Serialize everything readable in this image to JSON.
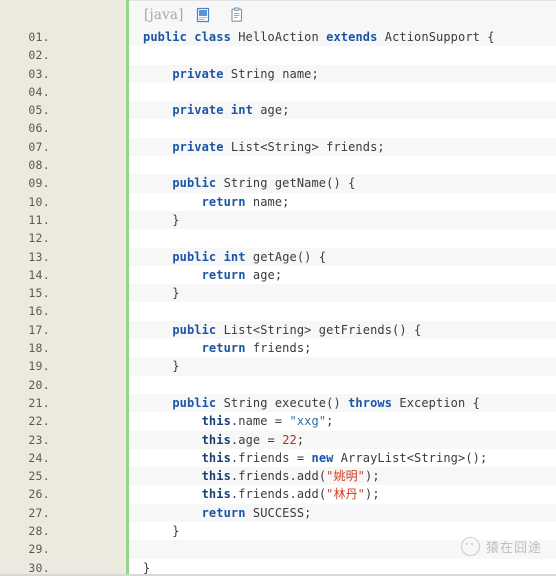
{
  "toolbar": {
    "language_label": "[java]",
    "icons": [
      {
        "name": "view-source-icon",
        "glyph": "view-source"
      },
      {
        "name": "copy-to-clipboard-icon",
        "glyph": "clipboard"
      }
    ]
  },
  "editor": {
    "line_numbers": [
      "01.",
      "02.",
      "03.",
      "04.",
      "05.",
      "06.",
      "07.",
      "08.",
      "09.",
      "10.",
      "11.",
      "12.",
      "13.",
      "14.",
      "15.",
      "16.",
      "17.",
      "18.",
      "19.",
      "20.",
      "21.",
      "22.",
      "23.",
      "24.",
      "25.",
      "26.",
      "27.",
      "28.",
      "29.",
      "30."
    ],
    "lines": [
      {
        "num": "01.",
        "tokens": [
          {
            "t": "public",
            "c": "k"
          },
          {
            "t": " ",
            "c": "p"
          },
          {
            "t": "class",
            "c": "k"
          },
          {
            "t": " HelloAction ",
            "c": "p"
          },
          {
            "t": "extends",
            "c": "k"
          },
          {
            "t": " ActionSupport {",
            "c": "p"
          }
        ]
      },
      {
        "num": "02.",
        "tokens": []
      },
      {
        "num": "03.",
        "tokens": [
          {
            "t": "    ",
            "c": "p"
          },
          {
            "t": "private",
            "c": "k"
          },
          {
            "t": " String name;",
            "c": "p"
          }
        ]
      },
      {
        "num": "04.",
        "tokens": []
      },
      {
        "num": "05.",
        "tokens": [
          {
            "t": "    ",
            "c": "p"
          },
          {
            "t": "private",
            "c": "k"
          },
          {
            "t": " ",
            "c": "p"
          },
          {
            "t": "int",
            "c": "k"
          },
          {
            "t": " age;",
            "c": "p"
          }
        ]
      },
      {
        "num": "06.",
        "tokens": []
      },
      {
        "num": "07.",
        "tokens": [
          {
            "t": "    ",
            "c": "p"
          },
          {
            "t": "private",
            "c": "k"
          },
          {
            "t": " List<String> friends;",
            "c": "p"
          }
        ]
      },
      {
        "num": "08.",
        "tokens": []
      },
      {
        "num": "09.",
        "tokens": [
          {
            "t": "    ",
            "c": "p"
          },
          {
            "t": "public",
            "c": "k"
          },
          {
            "t": " String getName() {",
            "c": "p"
          }
        ]
      },
      {
        "num": "10.",
        "tokens": [
          {
            "t": "        ",
            "c": "p"
          },
          {
            "t": "return",
            "c": "k"
          },
          {
            "t": " name;",
            "c": "p"
          }
        ]
      },
      {
        "num": "11.",
        "tokens": [
          {
            "t": "    }",
            "c": "p"
          }
        ]
      },
      {
        "num": "12.",
        "tokens": []
      },
      {
        "num": "13.",
        "tokens": [
          {
            "t": "    ",
            "c": "p"
          },
          {
            "t": "public",
            "c": "k"
          },
          {
            "t": " ",
            "c": "p"
          },
          {
            "t": "int",
            "c": "k"
          },
          {
            "t": " getAge() {",
            "c": "p"
          }
        ]
      },
      {
        "num": "14.",
        "tokens": [
          {
            "t": "        ",
            "c": "p"
          },
          {
            "t": "return",
            "c": "k"
          },
          {
            "t": " age;",
            "c": "p"
          }
        ]
      },
      {
        "num": "15.",
        "tokens": [
          {
            "t": "    }",
            "c": "p"
          }
        ]
      },
      {
        "num": "16.",
        "tokens": []
      },
      {
        "num": "17.",
        "tokens": [
          {
            "t": "    ",
            "c": "p"
          },
          {
            "t": "public",
            "c": "k"
          },
          {
            "t": " List<String> getFriends() {",
            "c": "p"
          }
        ]
      },
      {
        "num": "18.",
        "tokens": [
          {
            "t": "        ",
            "c": "p"
          },
          {
            "t": "return",
            "c": "k"
          },
          {
            "t": " friends;",
            "c": "p"
          }
        ]
      },
      {
        "num": "19.",
        "tokens": [
          {
            "t": "    }",
            "c": "p"
          }
        ]
      },
      {
        "num": "20.",
        "tokens": []
      },
      {
        "num": "21.",
        "tokens": [
          {
            "t": "    ",
            "c": "p"
          },
          {
            "t": "public",
            "c": "k"
          },
          {
            "t": " String execute() ",
            "c": "p"
          },
          {
            "t": "throws",
            "c": "k"
          },
          {
            "t": " Exception {",
            "c": "p"
          }
        ]
      },
      {
        "num": "22.",
        "tokens": [
          {
            "t": "        ",
            "c": "p"
          },
          {
            "t": "this",
            "c": "kt"
          },
          {
            "t": ".name = ",
            "c": "p"
          },
          {
            "t": "\"xxg\"",
            "c": "s"
          },
          {
            "t": ";",
            "c": "p"
          }
        ]
      },
      {
        "num": "23.",
        "tokens": [
          {
            "t": "        ",
            "c": "p"
          },
          {
            "t": "this",
            "c": "kt"
          },
          {
            "t": ".age = ",
            "c": "p"
          },
          {
            "t": "22",
            "c": "n"
          },
          {
            "t": ";",
            "c": "p"
          }
        ]
      },
      {
        "num": "24.",
        "tokens": [
          {
            "t": "        ",
            "c": "p"
          },
          {
            "t": "this",
            "c": "kt"
          },
          {
            "t": ".friends = ",
            "c": "p"
          },
          {
            "t": "new",
            "c": "k"
          },
          {
            "t": " ArrayList<String>();",
            "c": "p"
          }
        ]
      },
      {
        "num": "25.",
        "tokens": [
          {
            "t": "        ",
            "c": "p"
          },
          {
            "t": "this",
            "c": "kt"
          },
          {
            "t": ".friends.add(",
            "c": "p"
          },
          {
            "t": "\"姚明\"",
            "c": "sc"
          },
          {
            "t": ");",
            "c": "p"
          }
        ]
      },
      {
        "num": "26.",
        "tokens": [
          {
            "t": "        ",
            "c": "p"
          },
          {
            "t": "this",
            "c": "kt"
          },
          {
            "t": ".friends.add(",
            "c": "p"
          },
          {
            "t": "\"林丹\"",
            "c": "sc"
          },
          {
            "t": ");",
            "c": "p"
          }
        ]
      },
      {
        "num": "27.",
        "tokens": [
          {
            "t": "        ",
            "c": "p"
          },
          {
            "t": "return",
            "c": "k"
          },
          {
            "t": " SUCCESS;",
            "c": "p"
          }
        ]
      },
      {
        "num": "28.",
        "tokens": [
          {
            "t": "    }",
            "c": "p"
          }
        ]
      },
      {
        "num": "29.",
        "tokens": []
      },
      {
        "num": "30.",
        "tokens": [
          {
            "t": "}",
            "c": "p"
          }
        ]
      }
    ]
  },
  "watermark": {
    "text": "猿在囧途"
  },
  "colors": {
    "gutter_bg": "#eceadf",
    "gutter_accent": "#94d78a",
    "toolbar_bg": "#f7f7f7",
    "stripe_alt": "#f7f7f7",
    "keyword": "#1a56a8",
    "string": "#2b6fa8",
    "cjk_string": "#cc3f24",
    "number": "#b02f1e",
    "plain": "#3b3b3b"
  }
}
